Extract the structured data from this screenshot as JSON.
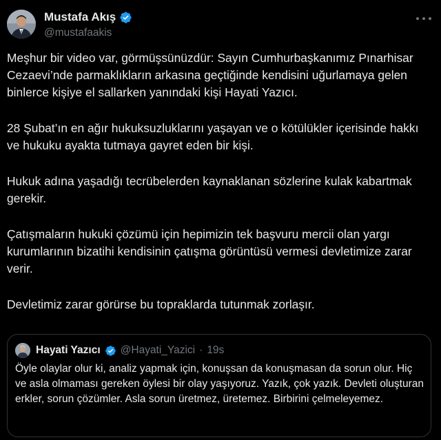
{
  "author": {
    "name": "Mustafa Akış",
    "handle": "@mustafaakis"
  },
  "tweet": {
    "paragraphs": [
      "Meşhur bir video var, görmüşsünüzdür: Sayın Cumhurbaşkanımız Pınarhisar Cezaevi’nde parmaklıkların arkasına geçtiğinde kendisini uğurlamaya gelen binlerce kişiye el sallarken yanındaki kişi Hayati Yazıcı.",
      "28 Şubat’ın en ağır hukuksuzluklarını yaşayan ve o kötülükler içerisinde hakkı ve hukuku ayakta tutmaya gayret eden bir kişi.",
      "Hukuk adına yaşadığı tecrübelerden kaynaklanan sözlerine kulak kabartmak gerekir.",
      "Çatışmaların hukuki çözümü için hepimizin tek başvuru mercii olan yargı kurumlarının bizatihi kendisinin çatışma görüntüsü vermesi devletimize zarar verir.",
      "Devletimiz zarar görürse bu topraklarda tutunmak zorlaşır."
    ]
  },
  "quote": {
    "name": "Hayati Yazıcı",
    "handle": "@Hayati_Yazici",
    "separator": "·",
    "time": "19s",
    "text": "Öyle olaylar olur ki, analiz yapmak için, konuşsan da konuşmasan da sorun olur. Hiç ve asla olmaması gereken öylesi bir olay yaşıyoruz. Yazık, çok yazık. Devleti oluşturan erkler, sorun çözümler. Asla sorun üretmez, üretemez. Birbirini çelmeleyemez."
  },
  "colors": {
    "background": "#000000",
    "text": "#e7e9ea",
    "secondary": "#71767b",
    "verified": "#1d9bf0",
    "border": "#2f3336"
  },
  "icons": {
    "verified": "verified-badge-icon",
    "more": "more-options-icon"
  }
}
